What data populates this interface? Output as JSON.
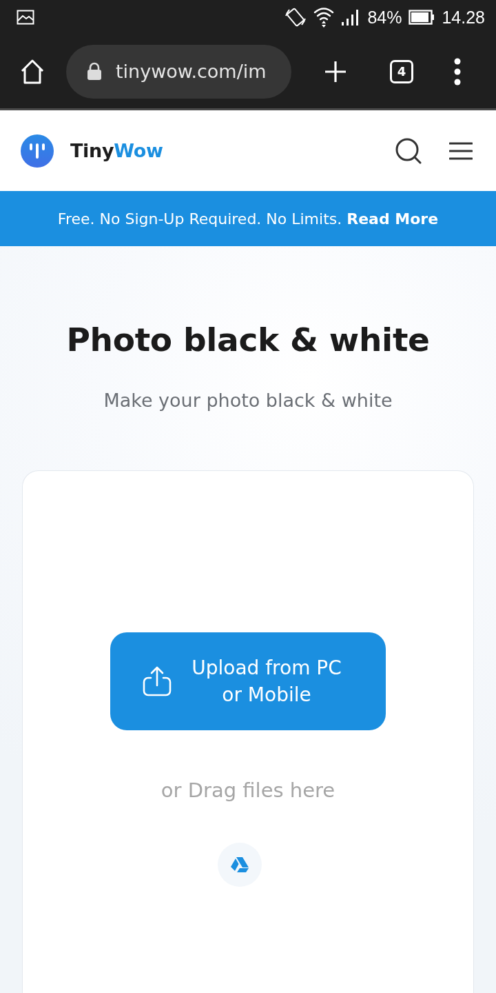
{
  "status_bar": {
    "battery": "84%",
    "time": "14.28"
  },
  "browser_toolbar": {
    "url": "tinywow.com/im",
    "tab_count": "4"
  },
  "site_header": {
    "brand": {
      "text": "Tiny",
      "accent": "Wow"
    }
  },
  "banner": {
    "text": "Free. No Sign-Up Required. No Limits.",
    "link": "Read More"
  },
  "hero": {
    "title": "Photo black & white",
    "subtitle": "Make your photo black & white"
  },
  "upload_card": {
    "button": "Upload from PC or Mobile",
    "drag_hint": "or Drag files here"
  }
}
